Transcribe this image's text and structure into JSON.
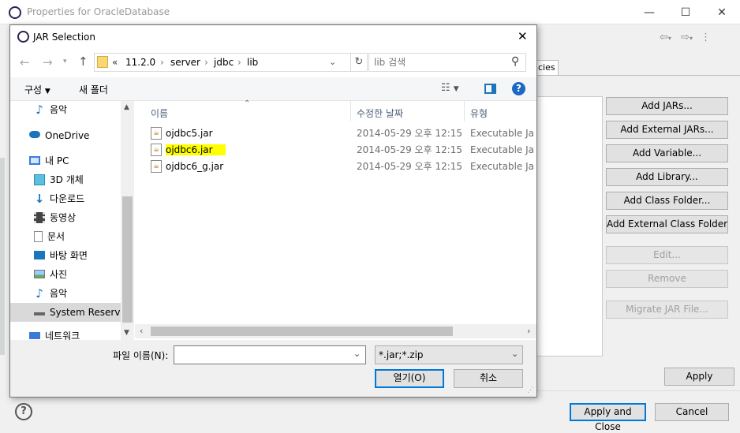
{
  "bg_window": {
    "title": "Properties for OracleDatabase",
    "tab_fragment": "ncies",
    "buttons": [
      "Add JARs...",
      "Add External JARs...",
      "Add Variable...",
      "Add Library...",
      "Add Class Folder...",
      "Add External Class Folder..."
    ],
    "disabled_buttons": [
      "Edit...",
      "Remove"
    ],
    "migrate_label": "Migrate JAR File...",
    "apply_label": "Apply",
    "apply_close_label": "Apply and Close",
    "cancel_label": "Cancel",
    "help_symbol": "?"
  },
  "dialog": {
    "title": "JAR Selection",
    "address": {
      "sep": "«",
      "path": [
        "11.2.0",
        "server",
        "jdbc",
        "lib"
      ]
    },
    "search_placeholder": "lib 검색",
    "toolbar": {
      "organize": "구성",
      "new_folder": "새 폴더"
    },
    "nav": [
      {
        "label": "음악",
        "icon": "music-icon"
      },
      {
        "label": "OneDrive",
        "icon": "cloud-icon"
      },
      {
        "label": "내 PC",
        "icon": "pc-icon"
      },
      {
        "label": "3D 개체",
        "icon": "cube-icon"
      },
      {
        "label": "다운로드",
        "icon": "download-icon"
      },
      {
        "label": "동영상",
        "icon": "video-icon"
      },
      {
        "label": "문서",
        "icon": "document-icon"
      },
      {
        "label": "바탕 화면",
        "icon": "desktop-icon"
      },
      {
        "label": "사진",
        "icon": "picture-icon"
      },
      {
        "label": "음악",
        "icon": "music-icon"
      },
      {
        "label": "System Reserved",
        "icon": "drive-icon"
      },
      {
        "label": "네트워크",
        "icon": "network-icon"
      }
    ],
    "columns": {
      "name": "이름",
      "date": "수정한 날짜",
      "type": "유형"
    },
    "files": [
      {
        "name": "ojdbc5.jar",
        "date": "2014-05-29 오후 12:15",
        "type": "Executable Jar File"
      },
      {
        "name": "ojdbc6.jar",
        "date": "2014-05-29 오후 12:15",
        "type": "Executable Jar File"
      },
      {
        "name": "ojdbc6_g.jar",
        "date": "2014-05-29 오후 12:15",
        "type": "Executable Jar File"
      }
    ],
    "filename_label": "파일 이름(N):",
    "filename_value": "",
    "filter_value": "*.jar;*.zip",
    "open_label": "열기(O)",
    "cancel_label": "취소"
  },
  "colors": {
    "highlight": "#ffff00",
    "accent": "#0078d7",
    "selected_nav": "#cce8ff"
  }
}
